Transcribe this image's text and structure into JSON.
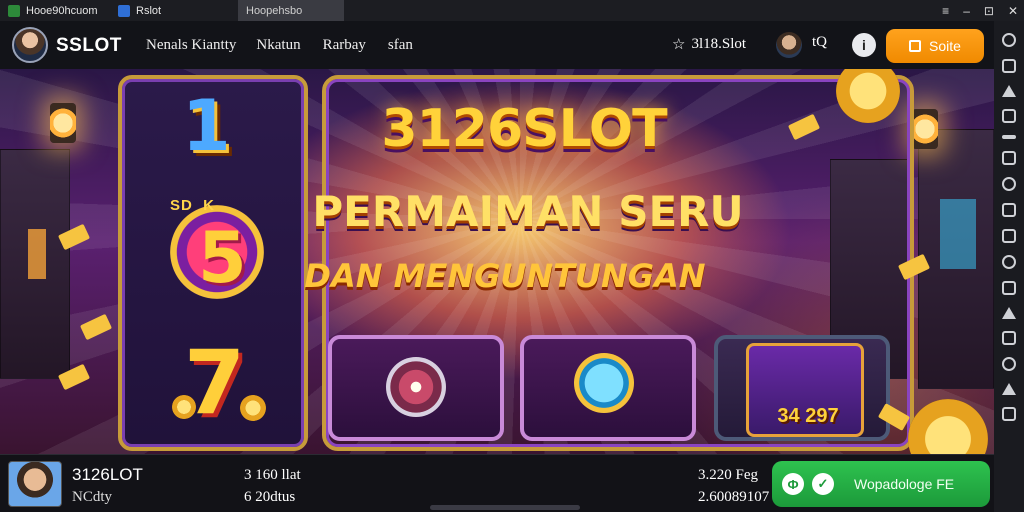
{
  "titlebar": {
    "app_tab": "Hooe90hcuom",
    "second_tab": "Rslot",
    "active_tab": "Hoopehsbo",
    "controls": [
      "≡",
      "–",
      "⊡",
      "✕"
    ]
  },
  "nav": {
    "brand": "SSLOT",
    "links": [
      "Nenals Kiantty",
      "Nkatun",
      "Rarbay",
      "sfan"
    ],
    "balance": "3l18.Slot",
    "search_label": "tQ",
    "info_label": "i",
    "cta_label": "Soite"
  },
  "banner": {
    "title_main": "3126SLOT",
    "title_sub": "PERMAIMAN SERU",
    "title_sub2": "DAN MENGUNTUNGAN",
    "symbol_one": "1",
    "symbol_five": "5",
    "symbol_seven": "7",
    "dial_text": "SD  K",
    "prize_value": "34 297"
  },
  "bottom": {
    "name": "3126LOT",
    "sub": "NCdty",
    "col1_top": "3 160 llat",
    "col1_bottom": "6 20dtus",
    "col2_top": "3.220 Feg",
    "col2_bottom": "2.60089107",
    "cta_label": "Wopadologe FE"
  },
  "colors": {
    "accent_orange": "#f08a00",
    "accent_green": "#1c9a3a",
    "gold": "#ffd23a"
  },
  "icons": [
    "star-icon",
    "search-icon",
    "info-icon",
    "menu-icon",
    "minimize-icon",
    "maximize-icon",
    "close-icon"
  ]
}
